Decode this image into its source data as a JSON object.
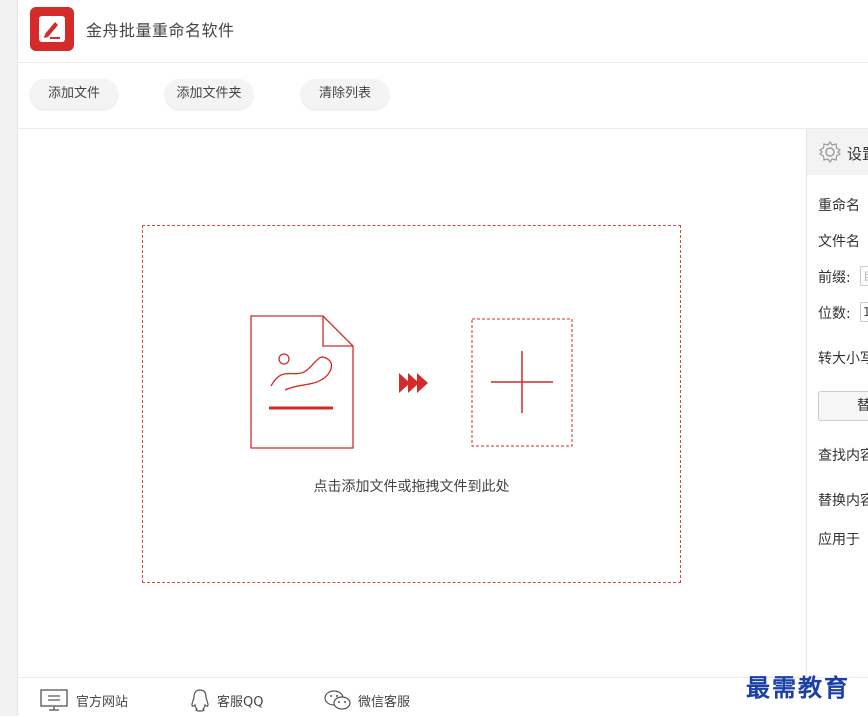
{
  "app": {
    "title": "金舟批量重命名软件"
  },
  "toolbar": {
    "add_file": "添加文件",
    "add_folder": "添加文件夹",
    "clear_list": "清除列表"
  },
  "dropzone": {
    "hint": "点击添加文件或拖拽文件到此处"
  },
  "settings_panel": {
    "header": "设置",
    "rename_label": "重命名",
    "filename_label": "文件名",
    "prefix_label": "前缀:",
    "prefix_placeholder": "自",
    "digits_label": "位数:",
    "digits_value": "1",
    "case_label": "转大小写",
    "replace_button": "替换",
    "find_label": "查找内容",
    "replace_label": "替换内容",
    "apply_label": "应用于"
  },
  "footer": {
    "website": "官方网站",
    "qq": "客服QQ",
    "wechat": "微信客服"
  },
  "watermark": "最需教育",
  "colors": {
    "accent": "#d42a2a",
    "dashed_border": "#d24a4a",
    "watermark": "#1a3fa8"
  }
}
